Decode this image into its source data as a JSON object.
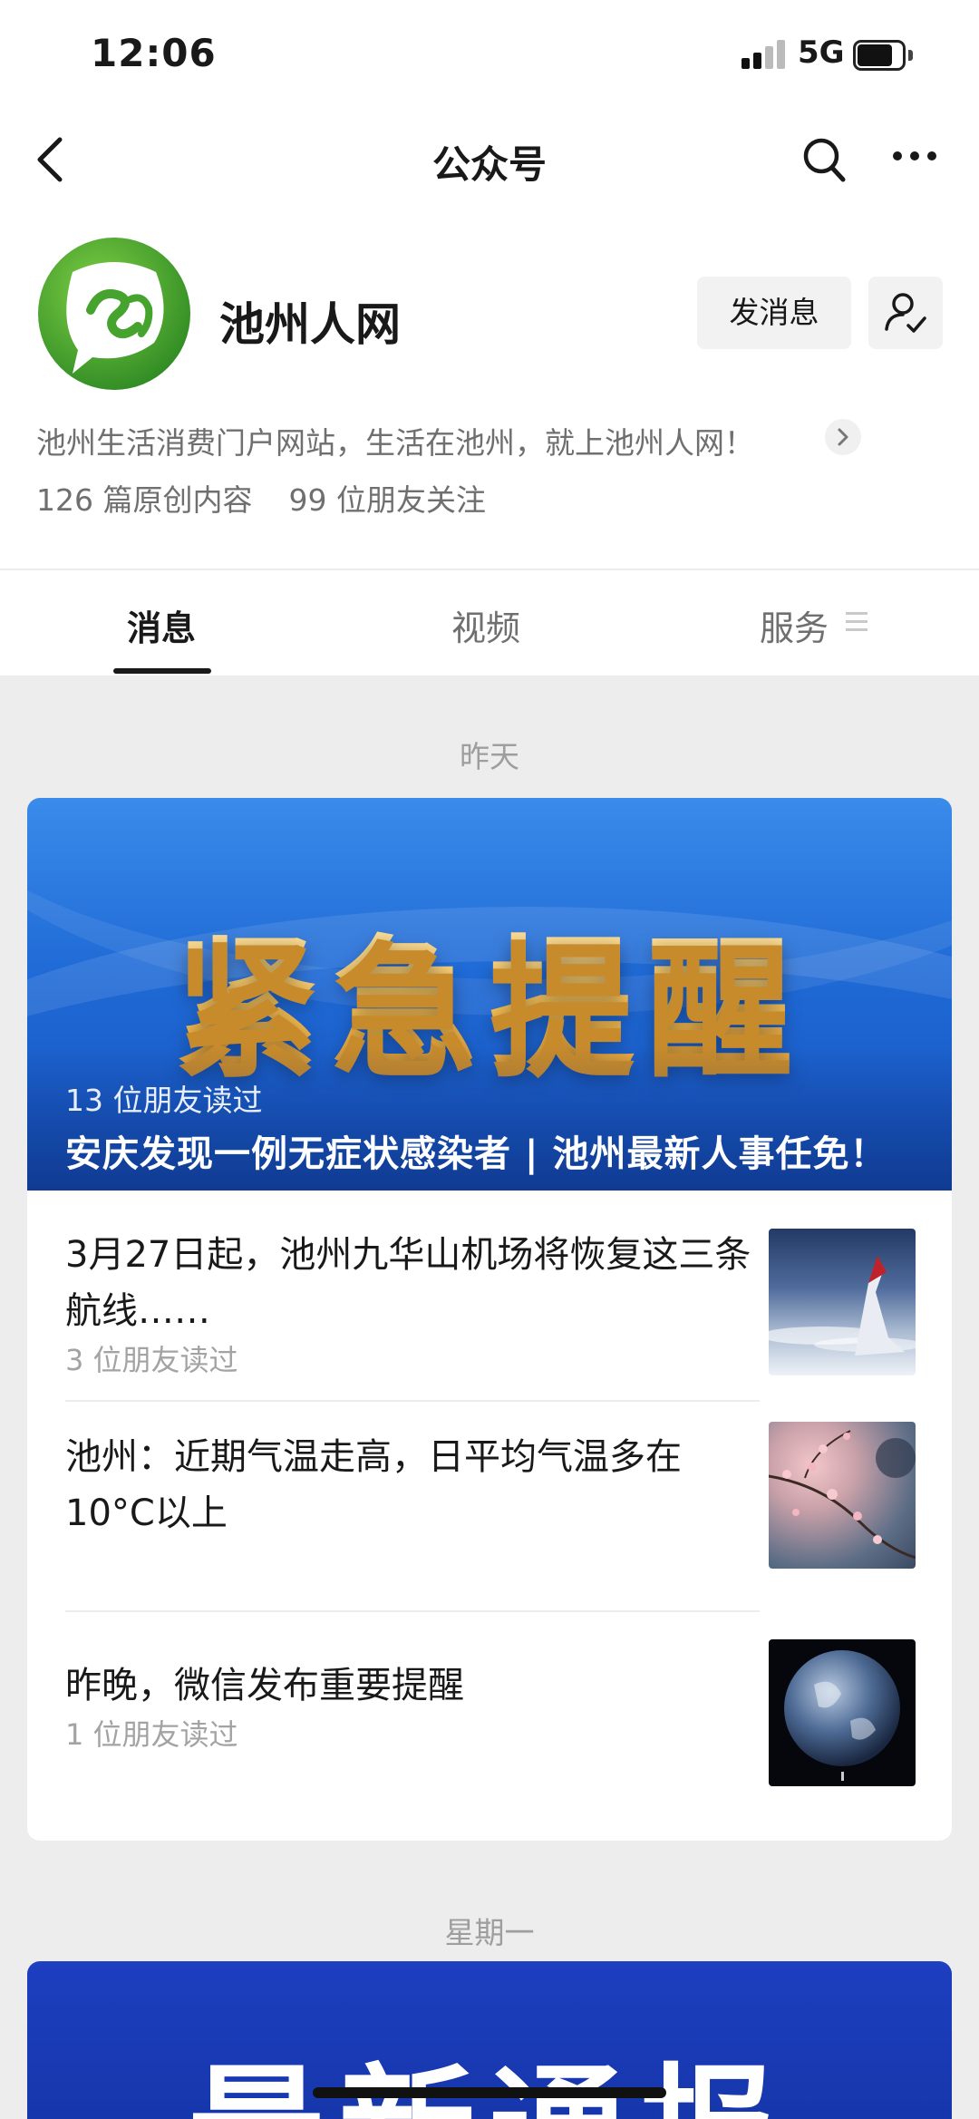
{
  "status_bar": {
    "time": "12:06",
    "network": "5G",
    "battery_level": 0.8
  },
  "nav": {
    "title": "公众号",
    "back_icon": "back-chevron-icon",
    "search_icon": "search-icon",
    "more_icon": "more-dots-icon"
  },
  "profile": {
    "name": "池州人网",
    "message_button": "发消息",
    "description": "池州生活消费门户网站，生活在池州，就上池州人网！",
    "original_count": "126 篇原创内容",
    "friends_following": "99 位朋友关注"
  },
  "tabs": [
    {
      "label": "消息",
      "active": true
    },
    {
      "label": "视频",
      "active": false
    },
    {
      "label": "服务",
      "active": false
    }
  ],
  "groups": [
    {
      "date": "昨天",
      "banner": {
        "image_text": "紧急提醒",
        "reads": "13 位朋友读过",
        "headline": "安庆发现一例无症状感染者 | 池州最新人事任免！"
      },
      "items": [
        {
          "title": "3月27日起，池州九华山机场将恢复这三条航线……",
          "reads": "3 位朋友读过",
          "thumb": "airplane-wing-image"
        },
        {
          "title": "池州：近期气温走高，日平均气温多在10°C以上",
          "reads": "",
          "thumb": "blossom-branch-image"
        },
        {
          "title": "昨晚，微信发布重要提醒",
          "reads": "1 位朋友读过",
          "thumb": "earth-image"
        }
      ]
    },
    {
      "date": "星期一",
      "banner": {
        "image_text": "最新通报"
      }
    }
  ]
}
